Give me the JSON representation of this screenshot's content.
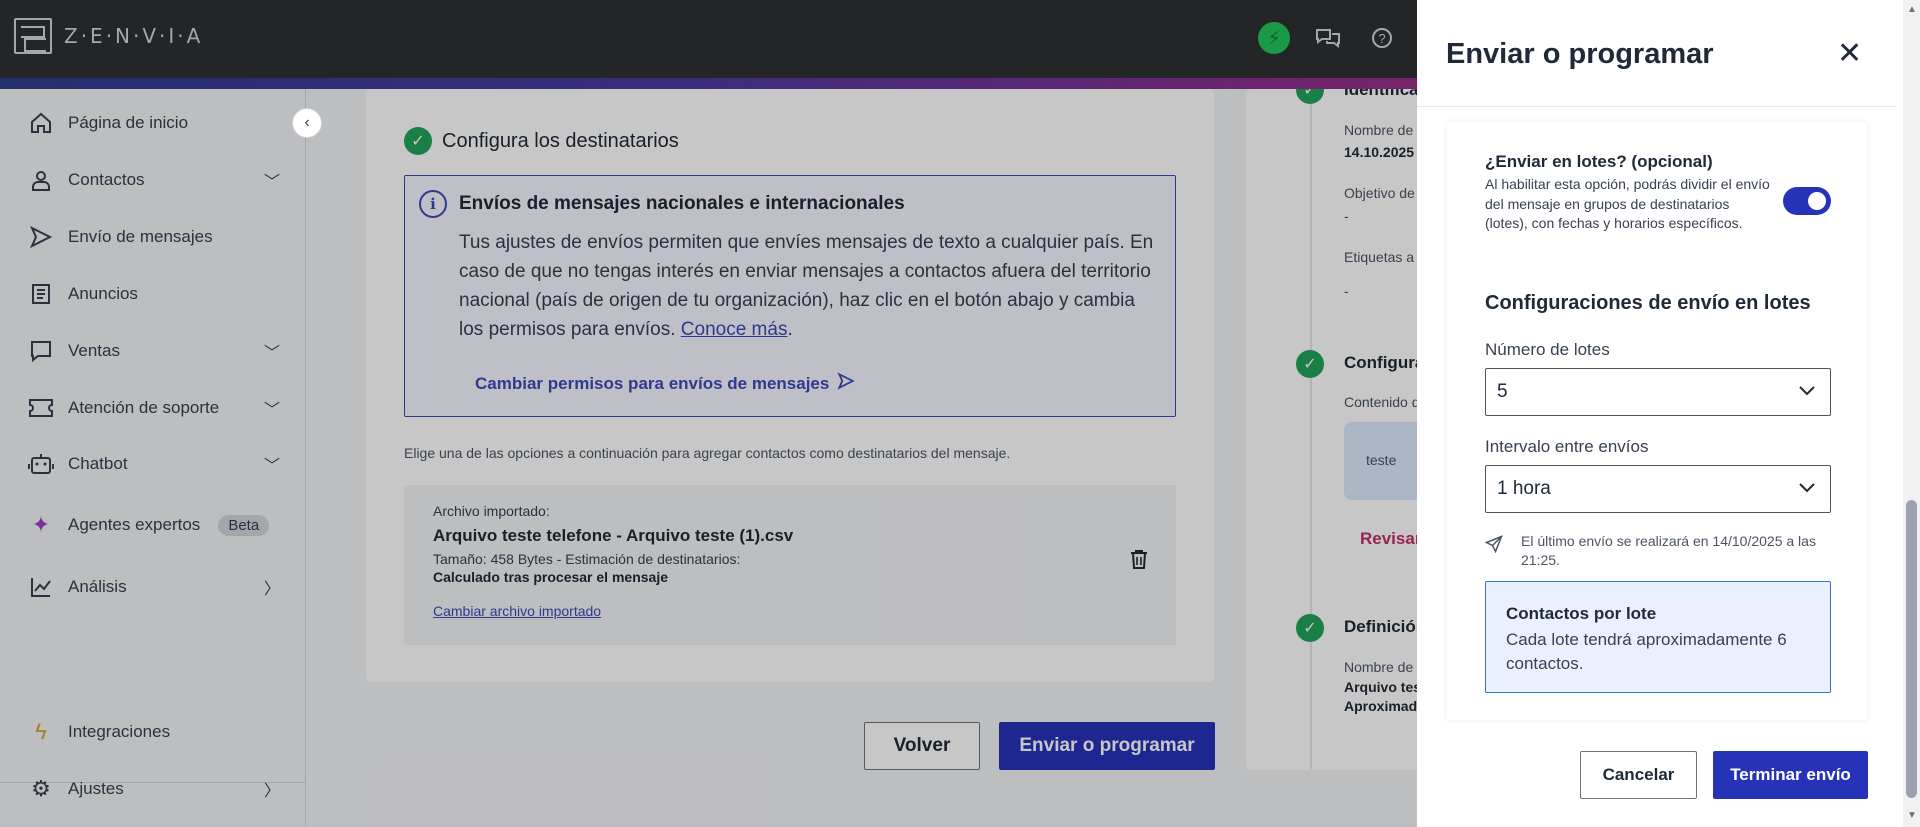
{
  "brand": {
    "logo_text": "Z·E·N·V·I·A"
  },
  "sidebar": {
    "items": [
      {
        "label": "Página de inicio",
        "icon": "home-icon"
      },
      {
        "label": "Contactos",
        "icon": "user-icon"
      },
      {
        "label": "Envío de mensajes",
        "icon": "send-icon"
      },
      {
        "label": "Anuncios",
        "icon": "document-icon"
      },
      {
        "label": "Ventas",
        "icon": "chat-icon"
      },
      {
        "label": "Atención de soporte",
        "icon": "ticket-icon"
      },
      {
        "label": "Chatbot",
        "icon": "bot-icon"
      },
      {
        "label": "Agentes expertos",
        "icon": "sparkle-icon",
        "badge": "Beta"
      },
      {
        "label": "Análisis",
        "icon": "chart-icon"
      },
      {
        "label": "Integraciones",
        "icon": "bolt-icon"
      },
      {
        "label": "Ajustes",
        "icon": "gear-icon"
      }
    ]
  },
  "main": {
    "step_title": "Configura los destinatarios",
    "info_title": "Envíos de mensajes nacionales e internacionales",
    "info_body": "Tus ajustes de envíos permiten que envíes mensajes de texto a cualquier país. En caso de que no tengas interés en enviar mensajes a contactos afuera del territorio nacional (país de origen de tu organización), haz clic en el botón abajo y cambia los permisos para envíos.",
    "info_link": "Conoce más",
    "info_period": ".",
    "permissions_link": "Cambiar permisos para envíos de mensajes",
    "hint": "Elige una de las opciones a continuación para agregar contactos como destinatarios del mensaje.",
    "file": {
      "label": "Archivo importado:",
      "name": "Arquivo teste telefone - Arquivo teste (1).csv",
      "meta": "Tamaño: 458 Bytes - Estimación de destinatarios:",
      "calc": "Calculado tras procesar el mensaje",
      "change": "Cambiar archivo importado"
    },
    "back_label": "Volver",
    "send_label": "Enviar o programar"
  },
  "summary": {
    "ident_title": "Identifica",
    "name_label": "Nombre de",
    "name_value": "14.10.2025",
    "goal_label": "Objetivo de",
    "goal_value": "-",
    "tags_label": "Etiquetas a",
    "tags_value": "-",
    "config_title": "Configura",
    "content_label": "Contenido d",
    "preview_text": "teste",
    "review": "Revisar",
    "def_title": "Definición",
    "def_label": "Nombre de",
    "def_value1": "Arquivo tes",
    "def_value2": "Aproximad"
  },
  "drawer": {
    "title": "Enviar o programar",
    "batch_title": "¿Enviar en lotes? (opcional)",
    "batch_desc": "Al habilitar esta opción, podrás dividir el envío del mensaje en grupos de destinatarios (lotes), con fechas y horarios específicos.",
    "batch_enabled": true,
    "config_title": "Configuraciones de envío en lotes",
    "lots_label": "Número de lotes",
    "lots_value": "5",
    "interval_label": "Intervalo entre envíos",
    "interval_value": "1 hora",
    "last_send": "El último envío se realizará en 14/10/2025 a las 21:25.",
    "contacts_title": "Contactos por lote",
    "contacts_desc": "Cada lote tendrá aproximadamente 6 contactos.",
    "cancel_label": "Cancelar",
    "finish_label": "Terminar envío"
  },
  "colors": {
    "primary": "#2633b8",
    "success": "#22a35a",
    "accent": "#c2306b",
    "topbar": "#2f3033"
  }
}
